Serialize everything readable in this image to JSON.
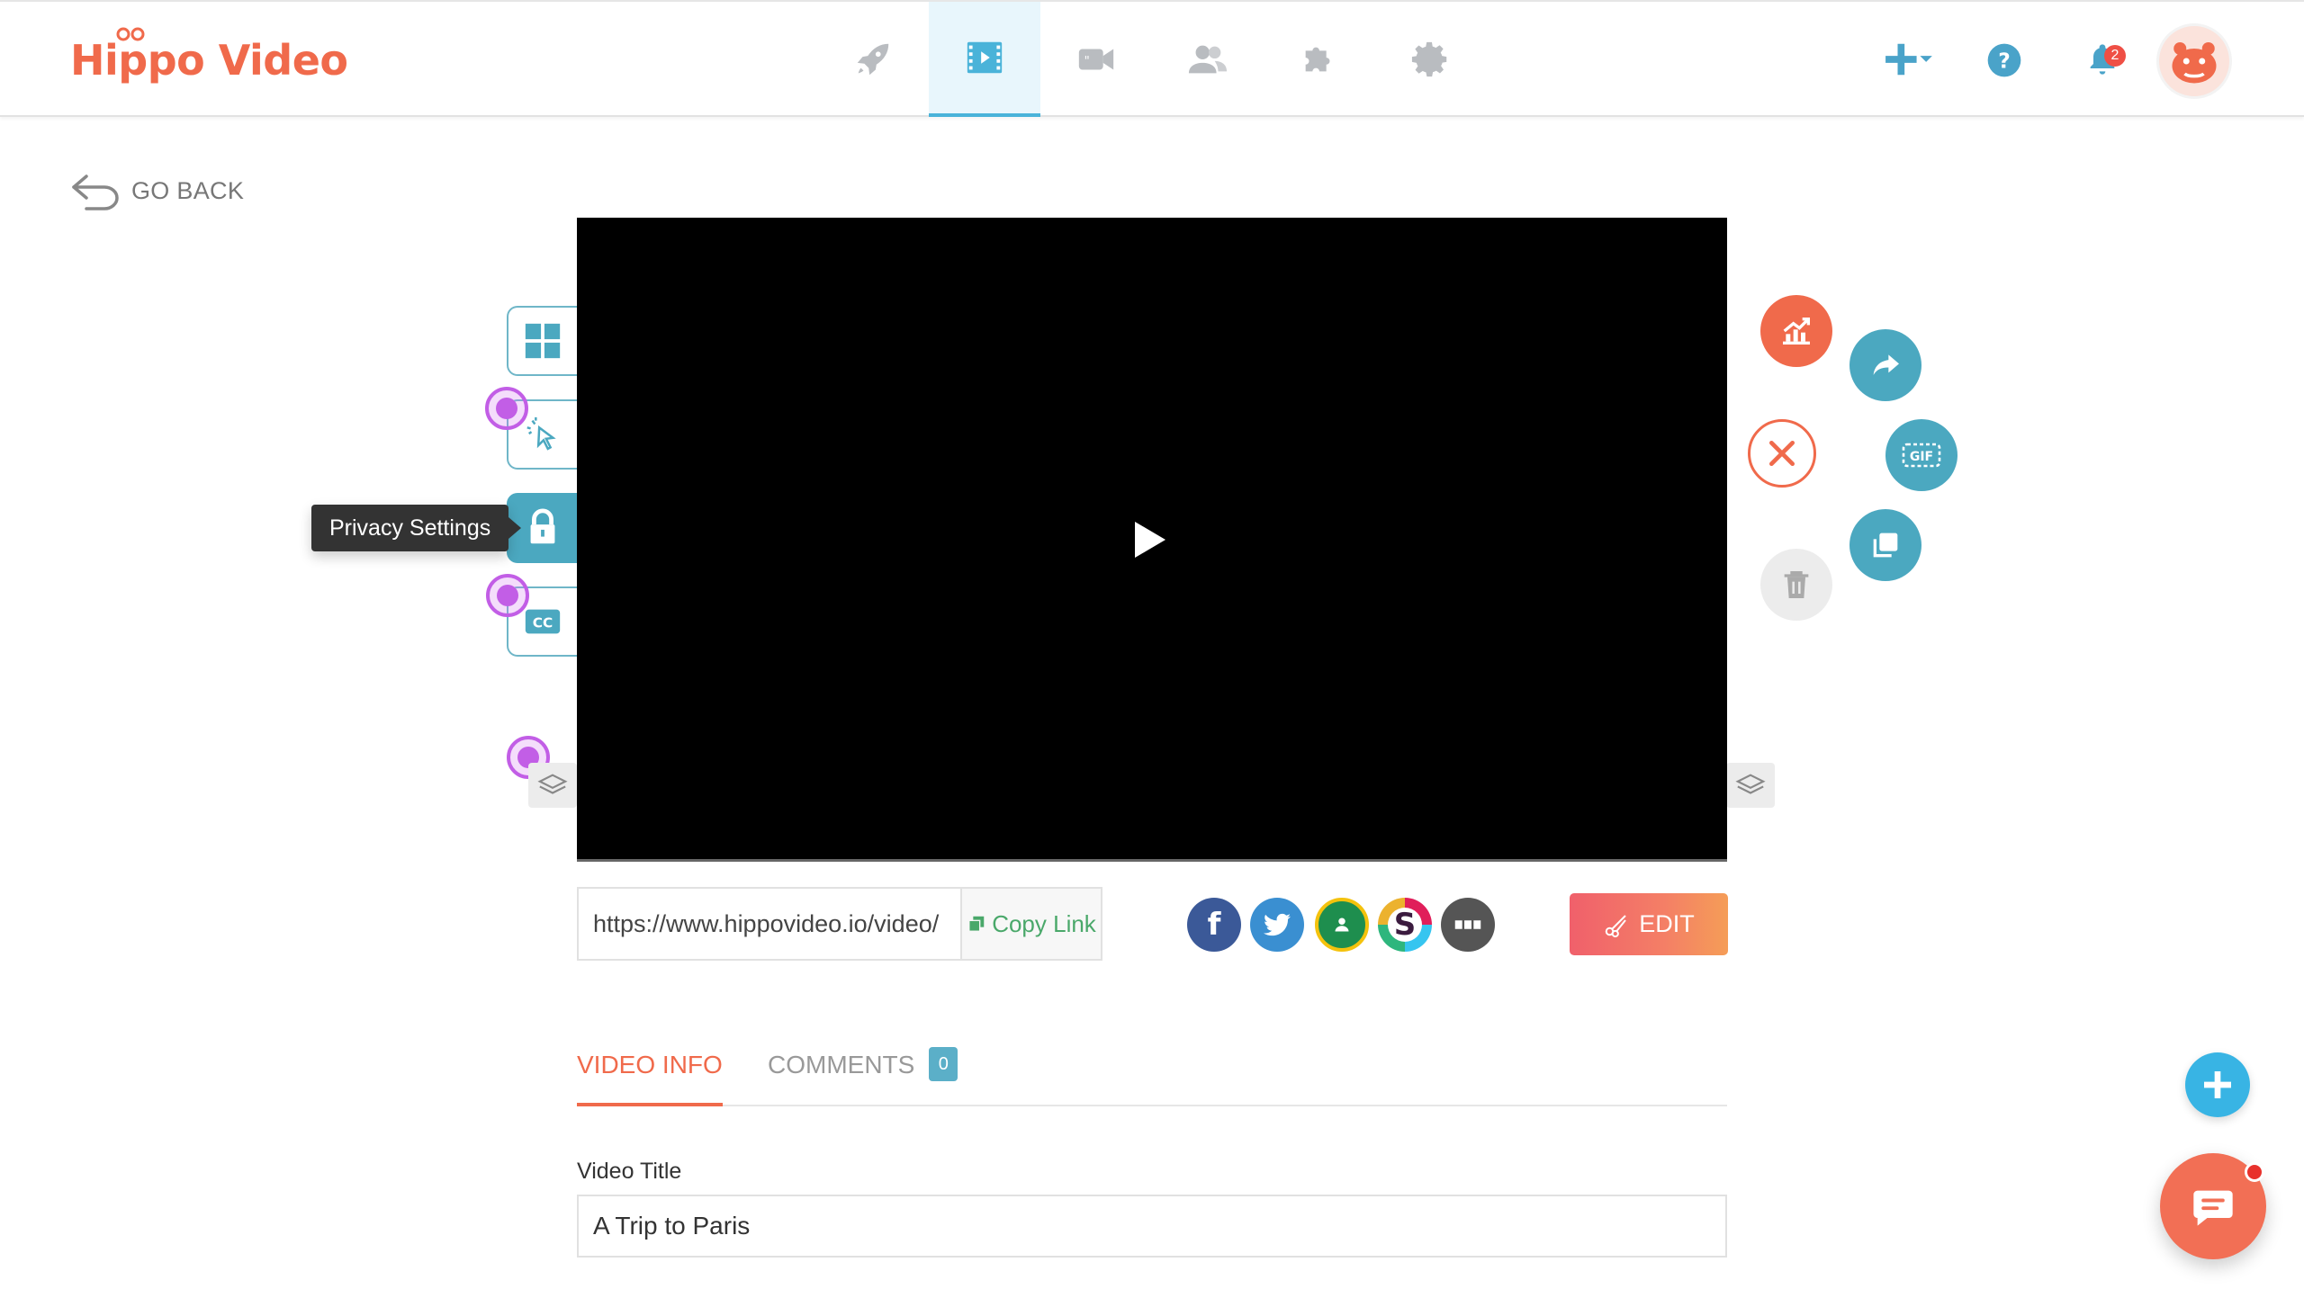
{
  "app": {
    "logo_text": "Hippo Video",
    "brand_color": "#f06a4b",
    "accent_color": "#4ab3d9"
  },
  "header": {
    "nav": [
      {
        "icon": "rocket-icon",
        "active": false
      },
      {
        "icon": "video-library-icon",
        "active": true
      },
      {
        "icon": "record-video-icon",
        "active": false
      },
      {
        "icon": "contacts-icon",
        "active": false
      },
      {
        "icon": "integrations-puzzle-icon",
        "active": false
      },
      {
        "icon": "settings-gear-icon",
        "active": false
      }
    ],
    "notification_count": "2"
  },
  "go_back": {
    "label": "GO BACK"
  },
  "video_toolbar": {
    "tooltip": "Privacy Settings",
    "buttons": [
      "layout-icon",
      "cursor-click-icon",
      "lock-icon",
      "closed-captions-icon"
    ]
  },
  "video_actions": [
    "analytics-icon",
    "share-icon",
    "close-icon",
    "gif-icon",
    "duplicate-icon",
    "trash-icon"
  ],
  "share": {
    "link_value": "https://www.hippovideo.io/video/",
    "copy_label": "Copy Link",
    "edit_label": "EDIT",
    "socials": [
      "facebook",
      "twitter",
      "google-classroom",
      "slack",
      "more"
    ]
  },
  "tabs": [
    {
      "label": "VIDEO INFO",
      "active": true
    },
    {
      "label": "COMMENTS",
      "count": "0",
      "active": false
    }
  ],
  "form": {
    "video_title_label": "Video Title",
    "video_title_value": "A Trip to Paris"
  }
}
